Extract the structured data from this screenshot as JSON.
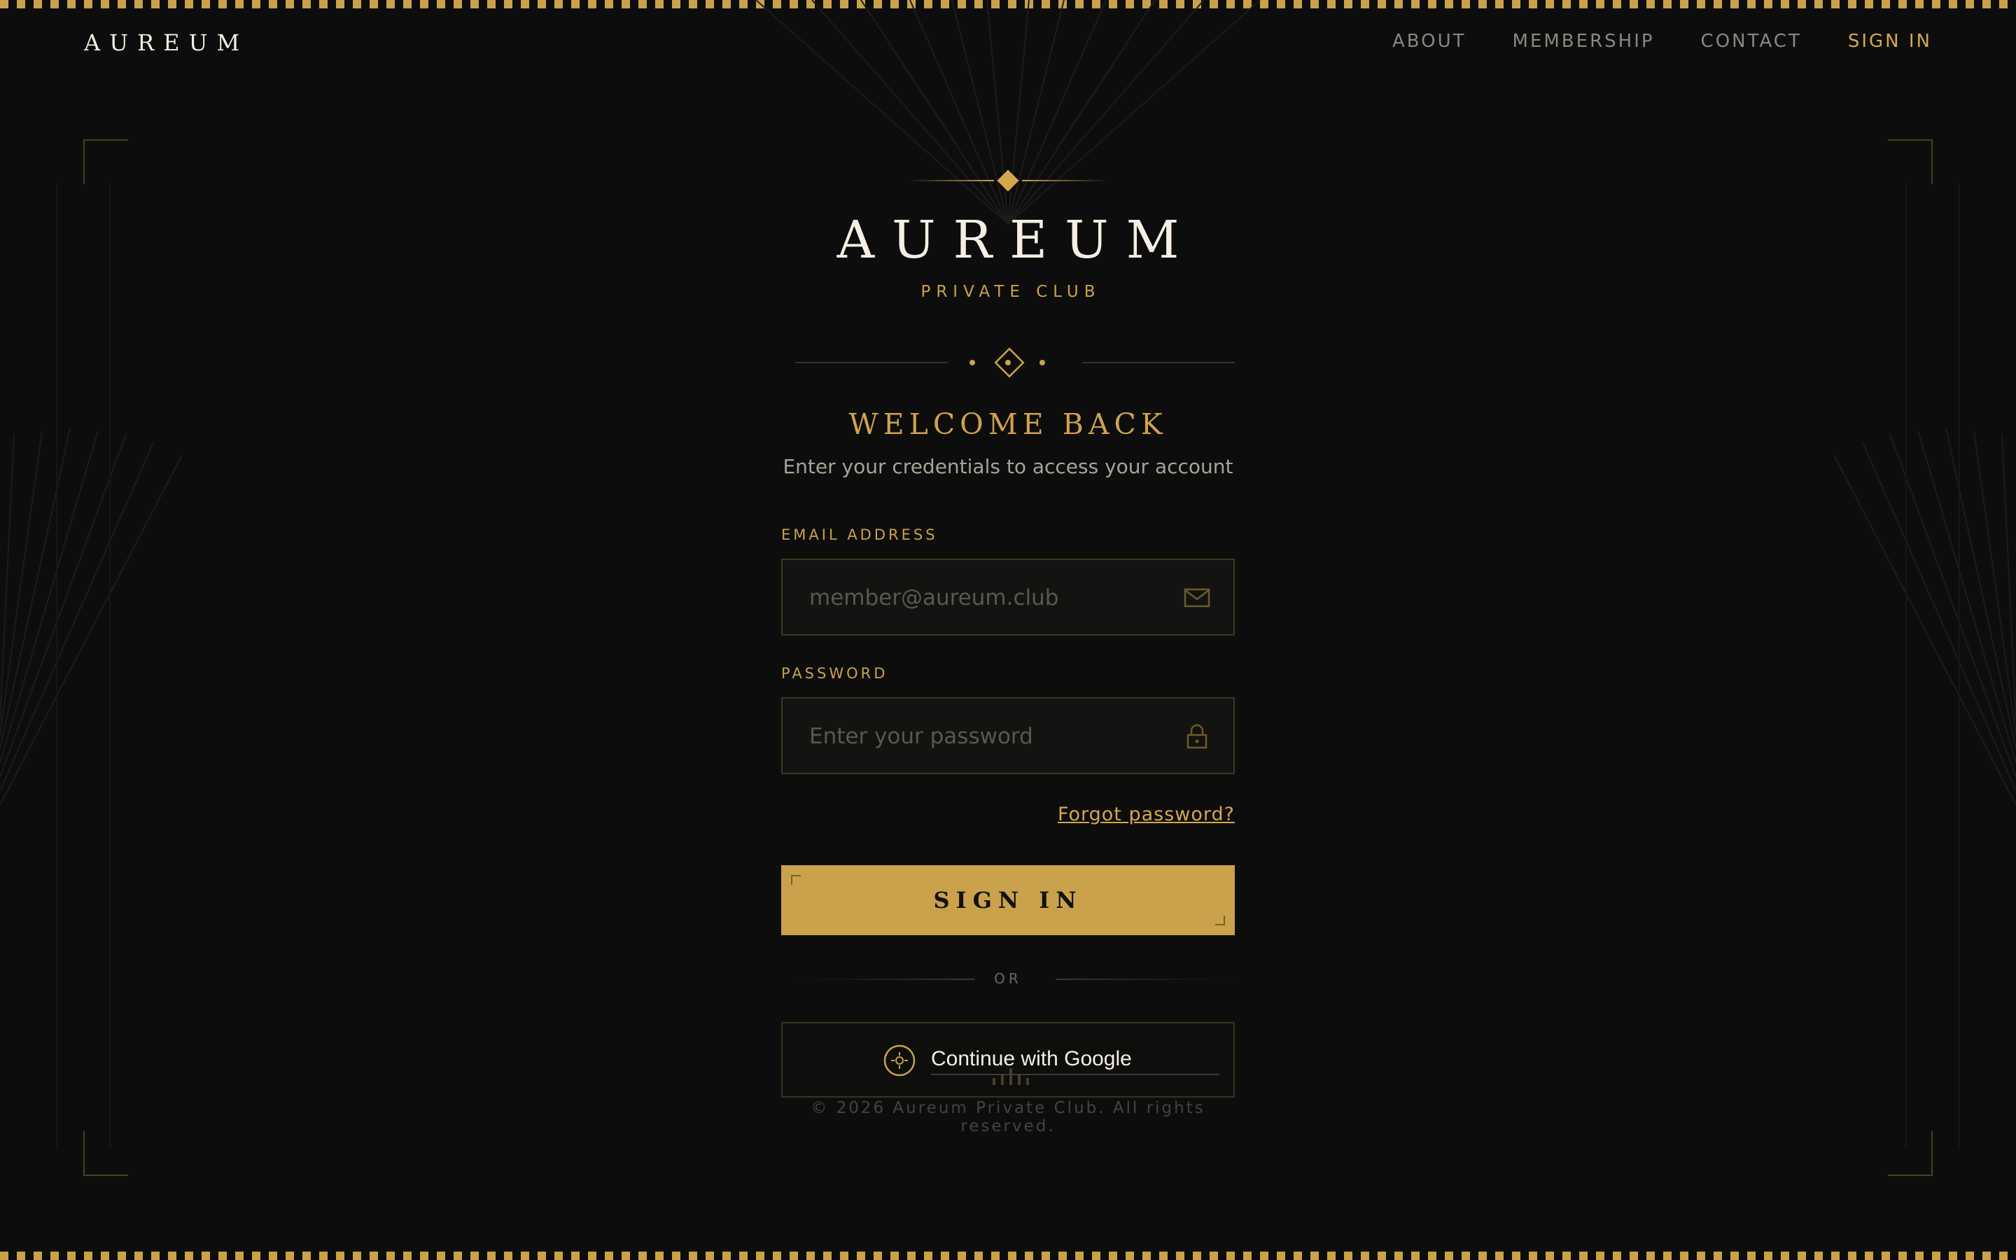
{
  "nav": {
    "brand": "AUREUM",
    "links": [
      {
        "label": "ABOUT",
        "active": false
      },
      {
        "label": "MEMBERSHIP",
        "active": false
      },
      {
        "label": "CONTACT",
        "active": false
      },
      {
        "label": "SIGN IN",
        "active": true
      }
    ]
  },
  "hero": {
    "logo": "AUREUM",
    "tagline": "PRIVATE CLUB",
    "title": "WELCOME BACK",
    "subtitle": "Enter your credentials to access your account"
  },
  "form": {
    "email": {
      "label": "EMAIL ADDRESS",
      "placeholder": "member@aureum.club",
      "value": "",
      "icon": "envelope-icon"
    },
    "password": {
      "label": "PASSWORD",
      "placeholder": "Enter your password",
      "value": "",
      "icon": "lock-icon"
    },
    "forgot_label": "Forgot password?",
    "submit_label": "SIGN IN",
    "divider_label": "OR",
    "google_label": "Continue with Google"
  },
  "footer": {
    "copyright": "© 2026 Aureum Private Club. All rights reserved."
  },
  "colors": {
    "gold": "#c9a24b",
    "background": "#0d0d0d",
    "ivory": "#f4efe2"
  }
}
